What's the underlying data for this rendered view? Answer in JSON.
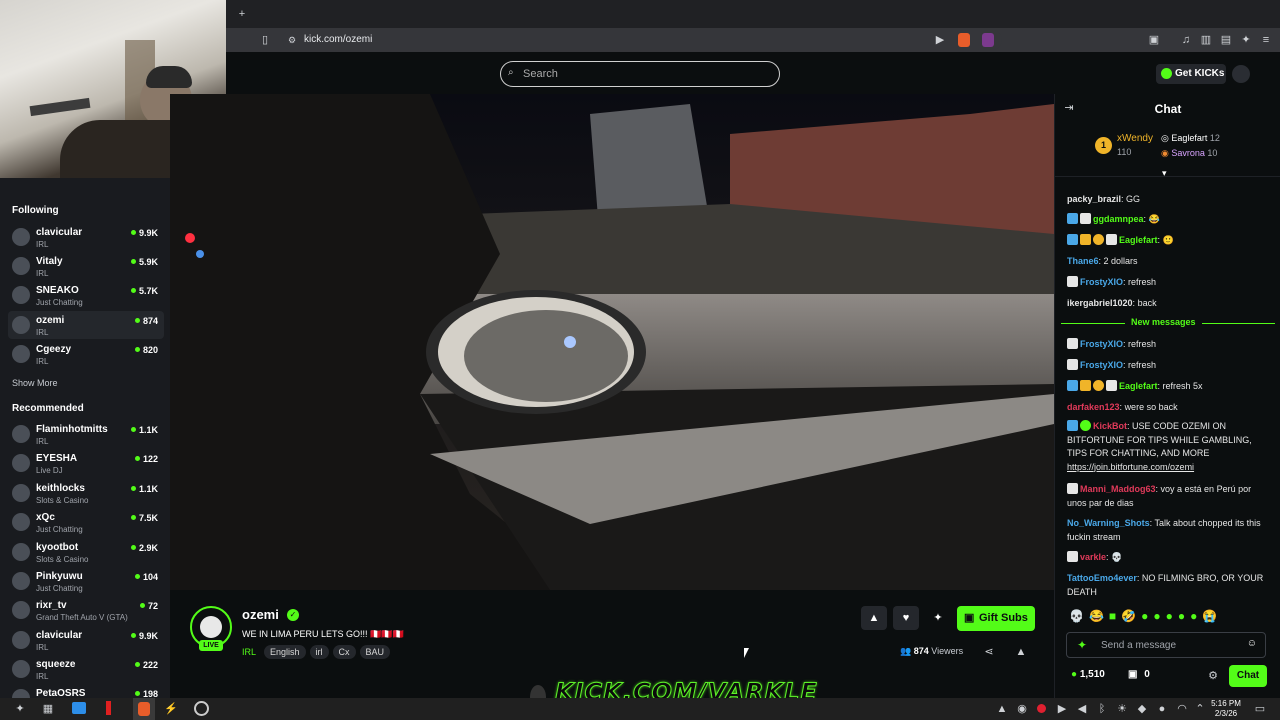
{
  "browser": {
    "url": "kick.com/ozemi",
    "new_tab": "+"
  },
  "header": {
    "search_placeholder": "Search",
    "get_kicks": "Get KICKs"
  },
  "sidebar": {
    "following_title": "Following",
    "following": [
      {
        "name": "clavicular",
        "category": "IRL",
        "viewers": "9.9K"
      },
      {
        "name": "Vitaly",
        "category": "IRL",
        "viewers": "5.9K"
      },
      {
        "name": "SNEAKO",
        "category": "Just Chatting",
        "viewers": "5.7K"
      },
      {
        "name": "ozemi",
        "category": "IRL",
        "viewers": "874"
      },
      {
        "name": "Cgeezy",
        "category": "IRL",
        "viewers": "820"
      }
    ],
    "show_more": "Show More",
    "recommended_title": "Recommended",
    "recommended": [
      {
        "name": "Flaminhotmitts",
        "category": "IRL",
        "viewers": "1.1K"
      },
      {
        "name": "EYESHA",
        "category": "Live DJ",
        "viewers": "122"
      },
      {
        "name": "keithlocks",
        "category": "Slots & Casino",
        "viewers": "1.1K"
      },
      {
        "name": "xQc",
        "category": "Just Chatting",
        "viewers": "7.5K"
      },
      {
        "name": "kyootbot",
        "category": "Slots & Casino",
        "viewers": "2.9K"
      },
      {
        "name": "Pinkyuwu",
        "category": "Just Chatting",
        "viewers": "104"
      },
      {
        "name": "rixr_tv",
        "category": "Grand Theft Auto V (GTA)",
        "viewers": "72"
      },
      {
        "name": "clavicular",
        "category": "IRL",
        "viewers": "9.9K"
      },
      {
        "name": "squeeze",
        "category": "IRL",
        "viewers": "222"
      },
      {
        "name": "PetaOSRS",
        "category": "",
        "viewers": "198"
      }
    ]
  },
  "stream": {
    "channel": "ozemi",
    "live_badge": "LIVE",
    "title": "WE IN LIMA PERU LETS GO!!! 🇵🇪🇵🇪🇵🇪",
    "category": "IRL",
    "tags": [
      "English",
      "irl",
      "Cx",
      "BAU"
    ],
    "viewers": "874",
    "viewers_label": "Viewers",
    "gift_subs": "Gift Subs"
  },
  "chat": {
    "title": "Chat",
    "top_gifters": {
      "first": {
        "name": "xWendy",
        "rank": "1",
        "count": "110"
      },
      "second": {
        "name": "Eaglefart",
        "count": "12"
      },
      "third": {
        "name": "Savrona",
        "count": "10"
      }
    },
    "messages_before": [
      {
        "user": "packy_brazil",
        "color": "#e6e6e6",
        "text": "GG"
      },
      {
        "user": "ggdamnpea",
        "color": "#53fc18",
        "text": ""
      },
      {
        "user": "Eaglefart",
        "color": "#53fc18",
        "text": ""
      },
      {
        "user": "Thane6",
        "color": "#4aa8e8",
        "text": "2 dollars"
      },
      {
        "user": "FrostyXIO",
        "color": "#4aa8e8",
        "text": "refresh"
      },
      {
        "user": "ikergabriel1020",
        "color": "#e6e6e6",
        "text": "back"
      }
    ],
    "new_messages_label": "New messages",
    "messages_after": [
      {
        "user": "FrostyXIO",
        "color": "#4aa8e8",
        "text": "refresh"
      },
      {
        "user": "FrostyXIO",
        "color": "#4aa8e8",
        "text": "refresh"
      },
      {
        "user": "Eaglefart",
        "color": "#53fc18",
        "text": "refresh 5x"
      },
      {
        "user": "darfaken123",
        "color": "#e03a5a",
        "text": "were so back"
      },
      {
        "user": "KickBot",
        "color": "#e03a5a",
        "text": "USE CODE OZEMI ON BITFORTUNE FOR TIPS WHILE GAMBLING, TIPS FOR CHATTING, AND MORE",
        "link": "https://join.bitfortune.com/ozemi"
      },
      {
        "user": "Manni_Maddog63",
        "color": "#e03a5a",
        "text": "voy a está en Perú por unos par de dias"
      },
      {
        "user": "No_Warning_Shots",
        "color": "#4aa8e8",
        "text": "Talk about chopped its this fuckin stream"
      },
      {
        "user": "varkle",
        "color": "#e03a5a",
        "text": ""
      },
      {
        "user": "TattooEmo4ever",
        "color": "#4aa8e8",
        "text": "NO FILMING BRO, OR YOUR DEATH"
      }
    ],
    "input_placeholder": "Send a message",
    "kicks_balance": "1,510",
    "sub_count": "0",
    "chat_button": "Chat"
  },
  "overlay": {
    "text": "KICK.COM/VARKLE"
  },
  "taskbar": {
    "time": "5:16 PM",
    "date": "2/3/26"
  }
}
